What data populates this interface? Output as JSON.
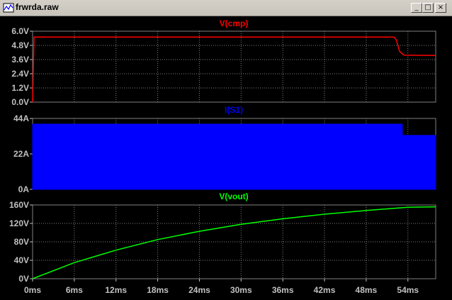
{
  "window": {
    "title": "frwrda.raw",
    "minimize_glyph": "_",
    "maximize_glyph": "□",
    "close_glyph": "×"
  },
  "colors": {
    "background": "#000000",
    "grid": "#808080",
    "axis_text": "#c0c0c0",
    "vcmp": "#ff0000",
    "is1": "#0000ff",
    "vout": "#00ff00"
  },
  "icons": [
    "waveform-file-icon",
    "minimize-icon",
    "maximize-icon",
    "close-icon"
  ],
  "chart_data": [
    {
      "type": "line",
      "title": "V(cmp)",
      "y_ticks": [
        "6.0V",
        "4.8V",
        "3.6V",
        "2.4V",
        "1.2V",
        "0.0V"
      ],
      "ylim": [
        0,
        6.0
      ],
      "xlim": [
        0,
        58
      ],
      "points": [
        [
          0,
          0
        ],
        [
          0.2,
          5.5
        ],
        [
          52,
          5.5
        ],
        [
          52.3,
          5.3
        ],
        [
          52.8,
          4.3
        ],
        [
          53.4,
          3.98
        ],
        [
          58,
          3.95
        ]
      ]
    },
    {
      "type": "area",
      "title": "I(S1)",
      "y_ticks": [
        "44A",
        "22A",
        "0A"
      ],
      "ylim": [
        0,
        44
      ],
      "xlim": [
        0,
        58
      ],
      "points": [
        [
          0,
          0
        ],
        [
          0,
          40.5
        ],
        [
          53.2,
          40.5
        ],
        [
          53.2,
          33.5
        ],
        [
          58,
          33.5
        ],
        [
          58,
          0
        ]
      ]
    },
    {
      "type": "line",
      "title": "V(vout)",
      "y_ticks": [
        "160V",
        "120V",
        "80V",
        "40V",
        "0V"
      ],
      "x_ticks": [
        "0ms",
        "6ms",
        "12ms",
        "18ms",
        "24ms",
        "30ms",
        "36ms",
        "42ms",
        "48ms",
        "54ms"
      ],
      "ylim": [
        0,
        160
      ],
      "xlim": [
        0,
        58
      ],
      "points": [
        [
          0,
          0
        ],
        [
          6,
          35
        ],
        [
          12,
          62
        ],
        [
          18,
          85
        ],
        [
          24,
          103
        ],
        [
          30,
          118
        ],
        [
          36,
          130
        ],
        [
          42,
          140
        ],
        [
          48,
          148
        ],
        [
          54,
          155
        ],
        [
          58,
          156
        ]
      ]
    }
  ]
}
